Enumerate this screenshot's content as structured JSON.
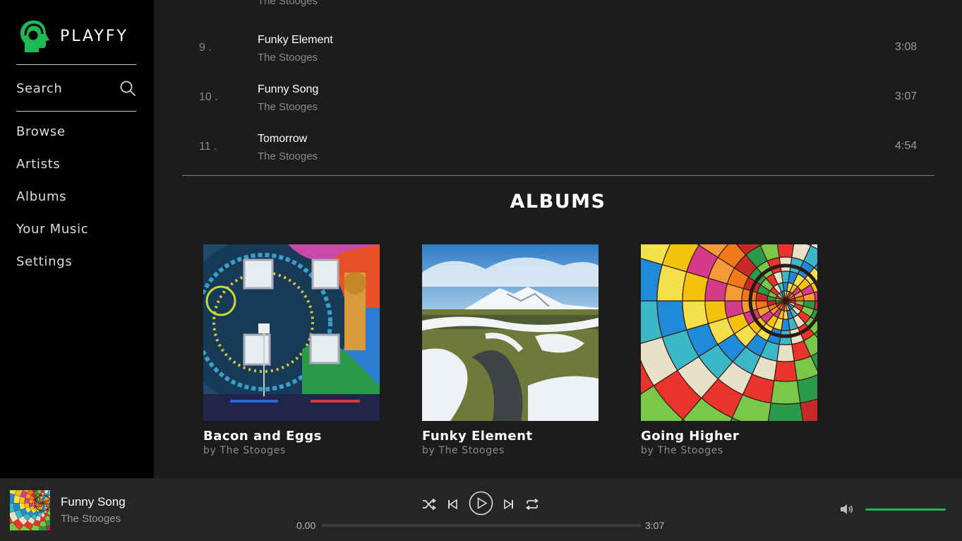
{
  "app": {
    "name": "PLAYFY",
    "accent": "#1db954"
  },
  "sidebar": {
    "search_label": "Search",
    "nav": [
      {
        "label": "Browse"
      },
      {
        "label": "Artists"
      },
      {
        "label": "Albums"
      },
      {
        "label": "Your Music"
      },
      {
        "label": "Settings"
      }
    ]
  },
  "tracklist": {
    "cut_artist": "The Stooges",
    "tracks": [
      {
        "number": "9 .",
        "title": "Funky Element",
        "artist": "The Stooges",
        "duration": "3:08"
      },
      {
        "number": "10 .",
        "title": "Funny Song",
        "artist": "The Stooges",
        "duration": "3:07"
      },
      {
        "number": "11 .",
        "title": "Tomorrow",
        "artist": "The Stooges",
        "duration": "4:54"
      }
    ]
  },
  "albums": {
    "heading": "ALBUMS",
    "items": [
      {
        "title": "Bacon and Eggs",
        "by": "by The Stooges",
        "art": "colorful street mural"
      },
      {
        "title": "Funky Element",
        "by": "by The Stooges",
        "art": "snowy mountain landscape"
      },
      {
        "title": "Going Higher",
        "by": "by The Stooges",
        "art": "hot air balloon interior"
      }
    ]
  },
  "player": {
    "title": "Funny Song",
    "artist": "The Stooges",
    "current_time": "0.00",
    "total_time": "3:07",
    "progress": 0,
    "volume": 1.0,
    "controls": [
      "shuffle-icon",
      "previous-icon",
      "play-icon",
      "next-icon",
      "repeat-icon",
      "volume-icon"
    ]
  }
}
